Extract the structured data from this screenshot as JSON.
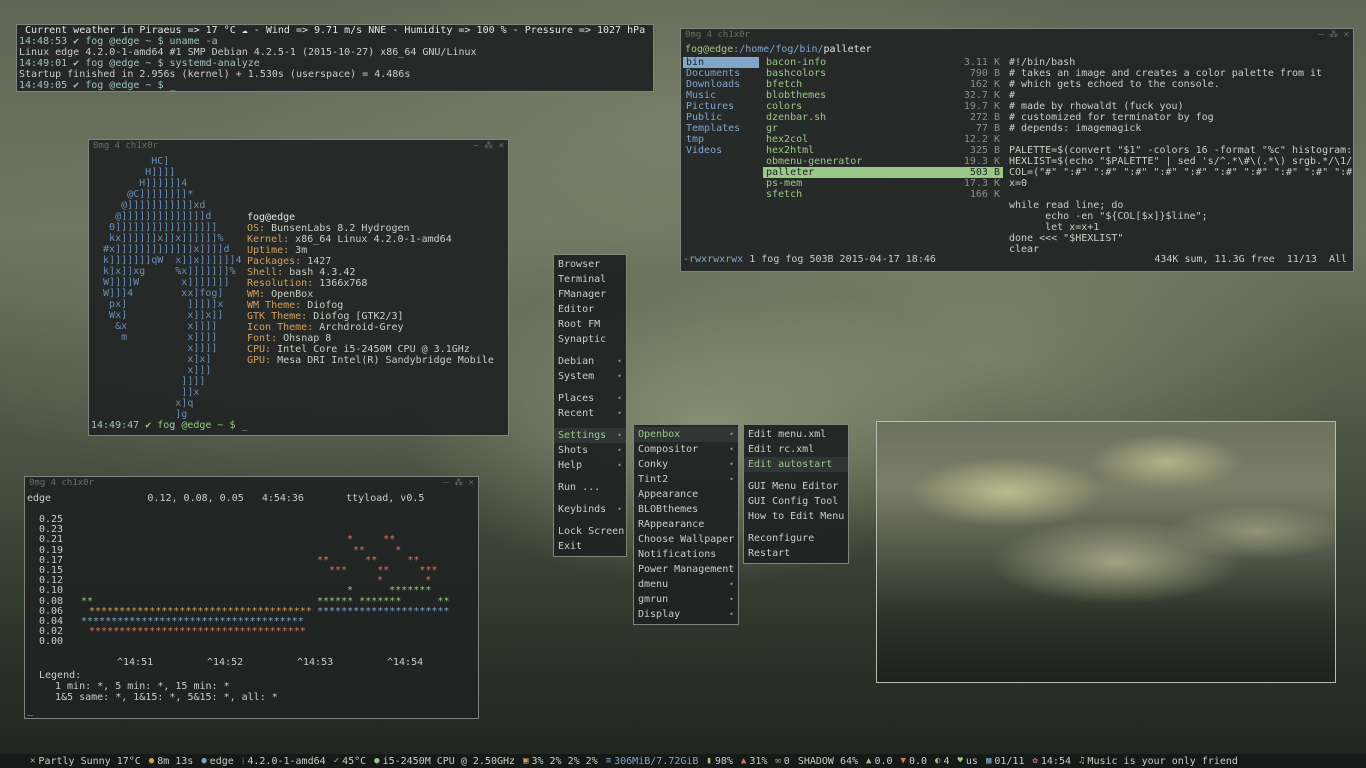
{
  "weather_term": {
    "lines": [
      " Current weather in Piraeus => 17 °C ☁ - Wind => 9.71 m/s NNE - Humidity => 100 % - Pressure => 1027 hPa",
      "14:48:53 ✔ fog @edge ~ $ uname -a",
      "Linux edge 4.2.0-1-amd64 #1 SMP Debian 4.2.5-1 (2015-10-27) x86_64 GNU/Linux",
      "14:49:01 ✔ fog @edge ~ $ systemd-analyze",
      "Startup finished in 2.956s (kernel) + 1.530s (userspace) = 4.486s",
      "14:49:05 ✔ fog @edge ~ $ _"
    ]
  },
  "neofetch": {
    "title": "0mg 4 ch1x0r",
    "window_controls": "– ⁂ ×",
    "logo": "          HC]\n         H]]]]\n        H]]]]]]4\n      @C]]]]]]]]*\n     @]]]]]]]]]]]xd\n    @]]]]]]]]]]]]]]d\n   0]]]]]]]]]]]]]]]]]\n   kx]]]]]]x]]x]]]]]]%\n  #x]]]]]]]]]]]]]x]]]]d\n  k]]]]]]]qW  x]]x]]]]]]4\n  k]x]]xg     %x]]]]]]]%\n  W]]]]W       x]]]]]]]\n  W]]]4        xx]fog]\n   px]          ]]]]]x\n   Wx]          x]]x]]\n    &x          x]]]]\n     m          x]]]]\n                x]]]]\n                x]x]\n                x]]]\n               ]]]]\n               ]]x\n              x]q\n              ]g\n             q",
    "user_host": "fog@edge",
    "fields": [
      {
        "k": "OS:",
        "v": " BunsenLabs 8.2 Hydrogen"
      },
      {
        "k": "Kernel:",
        "v": " x86_64 Linux 4.2.0-1-amd64"
      },
      {
        "k": "Uptime:",
        "v": " 3m"
      },
      {
        "k": "Packages:",
        "v": " 1427"
      },
      {
        "k": "Shell:",
        "v": " bash 4.3.42"
      },
      {
        "k": "Resolution:",
        "v": " 1366x768"
      },
      {
        "k": "WM:",
        "v": " OpenBox"
      },
      {
        "k": "WM Theme:",
        "v": " Diofog"
      },
      {
        "k": "GTK Theme:",
        "v": " Diofog [GTK2/3]"
      },
      {
        "k": "Icon Theme:",
        "v": " Archdroid-Grey"
      },
      {
        "k": "Font:",
        "v": " Ohsnap 8"
      },
      {
        "k": "CPU:",
        "v": " Intel Core i5-2450M CPU @ 3.1GHz"
      },
      {
        "k": "GPU:",
        "v": " Mesa DRI Intel(R) Sandybridge Mobile"
      }
    ],
    "prompt_time": "14:49:47",
    "prompt_rest": " ✔ fog @edge ~ $ _"
  },
  "ranger": {
    "title": "0mg 4 ch1x0r",
    "window_controls": "– ⁂ ×",
    "path_user": "fog@edge",
    "path_dir": ":/home/fog/bin/",
    "path_file": "palleter",
    "col1": [
      "bin",
      "Documents",
      "Downloads",
      "Music",
      "Pictures",
      "Public",
      "Templates",
      "tmp",
      "Videos"
    ],
    "col2": [
      {
        "name": "bacon-info",
        "size": "3.11 K"
      },
      {
        "name": "bashcolors",
        "size": "790 B"
      },
      {
        "name": "bfetch",
        "size": "162 K"
      },
      {
        "name": "blobthemes",
        "size": "32.7 K"
      },
      {
        "name": "colors",
        "size": "19.7 K"
      },
      {
        "name": "dzenbar.sh",
        "size": "272 B"
      },
      {
        "name": "gr",
        "size": "77 B"
      },
      {
        "name": "hex2col",
        "size": "12.2 K"
      },
      {
        "name": "hex2html",
        "size": "325 B"
      },
      {
        "name": "obmenu-generator",
        "size": "19.3 K"
      },
      {
        "name": "palleter",
        "size": "503 B"
      },
      {
        "name": "ps-mem",
        "size": "17.3 K"
      },
      {
        "name": "sfetch",
        "size": "166 K"
      }
    ],
    "code": [
      "#!/bin/bash",
      "# takes an image and creates a color palette from it",
      "# which gets echoed to the console.",
      "#",
      "# made by rhowaldt (fuck you)",
      "# customized for terminator by fog",
      "# depends: imagemagick",
      "",
      "PALETTE=$(convert \"$1\" -colors 16 -format \"%c\" histogram:",
      "HEXLIST=$(echo \"$PALETTE\" | sed 's/^.*\\#\\(.*\\) srgb.*/\\1/",
      "COL=(\"#\" \":#\" \":#\" \":#\" \":#\" \":#\" \":#\" \":#\" \":#\" \":#\" \":#",
      "x=0",
      "",
      "while read line; do",
      "      echo -en \"${COL[$x]}$line\";",
      "      let x=x+1",
      "done <<< \"$HEXLIST\"",
      "clear"
    ],
    "status_perm": "-rwxrwxrwx",
    "status_info": " 1 fog fog 503B 2015-04-17 18:46",
    "status_right": "434K sum, 11.3G free  11/13  All"
  },
  "menu_root": [
    {
      "label": "Browser",
      "sub": false
    },
    {
      "label": "Terminal",
      "sub": false
    },
    {
      "label": "FManager",
      "sub": false
    },
    {
      "label": "Editor",
      "sub": false
    },
    {
      "label": "Root FM",
      "sub": false
    },
    {
      "label": "Synaptic",
      "sub": false
    },
    {
      "sep": true
    },
    {
      "label": "Debian",
      "sub": true
    },
    {
      "label": "System",
      "sub": true
    },
    {
      "sep": true
    },
    {
      "label": "Places",
      "sub": true
    },
    {
      "label": "Recent",
      "sub": true
    },
    {
      "sep": true
    },
    {
      "label": "Settings",
      "sub": true,
      "active": true
    },
    {
      "label": "Shots",
      "sub": true
    },
    {
      "label": "Help",
      "sub": true
    },
    {
      "sep": true
    },
    {
      "label": "Run ...",
      "sub": false
    },
    {
      "sep": true
    },
    {
      "label": "Keybinds",
      "sub": true
    },
    {
      "sep": true
    },
    {
      "label": "Lock Screen",
      "sub": false
    },
    {
      "label": "Exit",
      "sub": false
    }
  ],
  "menu_openbox": [
    {
      "label": "Openbox",
      "sub": true,
      "active": true
    },
    {
      "label": "Compositor",
      "sub": true
    },
    {
      "label": "Conky",
      "sub": true
    },
    {
      "label": "Tint2",
      "sub": true
    },
    {
      "label": "Appearance",
      "sub": false
    },
    {
      "label": "BLOBthemes",
      "sub": false
    },
    {
      "label": "RAppearance",
      "sub": false
    },
    {
      "label": "Choose Wallpaper",
      "sub": false
    },
    {
      "label": "Notifications",
      "sub": false
    },
    {
      "label": "Power Management",
      "sub": false
    },
    {
      "label": "dmenu",
      "sub": true
    },
    {
      "label": "gmrun",
      "sub": true
    },
    {
      "label": "Display",
      "sub": true
    }
  ],
  "menu_edit": [
    {
      "label": "Edit menu.xml",
      "sub": false
    },
    {
      "label": "Edit rc.xml",
      "sub": false
    },
    {
      "label": "Edit autostart",
      "sub": false,
      "active": true
    },
    {
      "sep": true
    },
    {
      "label": "GUI Menu Editor",
      "sub": false
    },
    {
      "label": "GUI Config Tool",
      "sub": false
    },
    {
      "label": "How to Edit Menu",
      "sub": false
    },
    {
      "sep": true
    },
    {
      "label": "Reconfigure",
      "sub": false
    },
    {
      "label": "Restart",
      "sub": false
    }
  ],
  "ttyload": {
    "title": "0mg 4 ch1x0r",
    "window_controls": "– ⁂ ×",
    "host": "edge",
    "loads": "0.12, 0.08, 0.05",
    "time": "4:54:36",
    "version": "ttyload, v0.5",
    "y_labels": [
      "0.25",
      "0.23",
      "0.21",
      "0.19",
      "0.17",
      "0.15",
      "0.12",
      "0.10",
      "0.08",
      "0.06",
      "0.04",
      "0.02",
      "0.00"
    ],
    "x_labels": [
      "^14:51",
      "^14:52",
      "^14:53",
      "^14:54"
    ],
    "legend_title": "Legend:",
    "legend_1": "1 min: *, 5 min: *, 15 min: *",
    "legend_2": "1&5 same: *, 1&15: *, 5&15: *, all: *",
    "cursor": "_"
  },
  "statusbar": [
    {
      "icon": "✕",
      "color": "#9ac887",
      "text": "Partly Sunny 17°C"
    },
    {
      "icon": "●",
      "color": "#d0a061",
      "text": "8m 13s"
    },
    {
      "icon": "●",
      "color": "#80a6cc",
      "text": "edge"
    },
    {
      "icon": "⁞",
      "color": "#c07a9a",
      "text": "4.2.0-1-amd64"
    },
    {
      "icon": "✓",
      "color": "#9ac887",
      "text": "45°C"
    },
    {
      "icon": "●",
      "color": "#9ac887",
      "text": "i5-2450M CPU @ 2.50GHz"
    },
    {
      "icon": "▣",
      "color": "#d0a061",
      "text": "3% 2% 2% 2%"
    },
    {
      "icon": "≡",
      "color": "#80a6cc",
      "text": "306MiB/7.72GiB"
    },
    {
      "icon": "▮",
      "color": "#9ac887",
      "text": "98%"
    },
    {
      "icon": "▲",
      "color": "#d57b62",
      "text": "31%"
    },
    {
      "icon": "✉",
      "color": "#9ac887",
      "text": "0"
    },
    {
      "icon": "",
      "color": "#c8cfc6",
      "text": "SHADOW 64%"
    },
    {
      "icon": "▲",
      "color": "#9ac887",
      "text": "0.0"
    },
    {
      "icon": "▼",
      "color": "#d57b62",
      "text": "0.0"
    },
    {
      "icon": "◐",
      "color": "#9ac887",
      "text": "4"
    },
    {
      "icon": "♥",
      "color": "#9ac887",
      "text": "us"
    },
    {
      "icon": "▦",
      "color": "#80a6cc",
      "text": "01/11"
    },
    {
      "icon": "✿",
      "color": "#c07a9a",
      "text": "14:54"
    },
    {
      "icon": "♫",
      "color": "#9ac887",
      "text": "Music is your only friend"
    }
  ]
}
